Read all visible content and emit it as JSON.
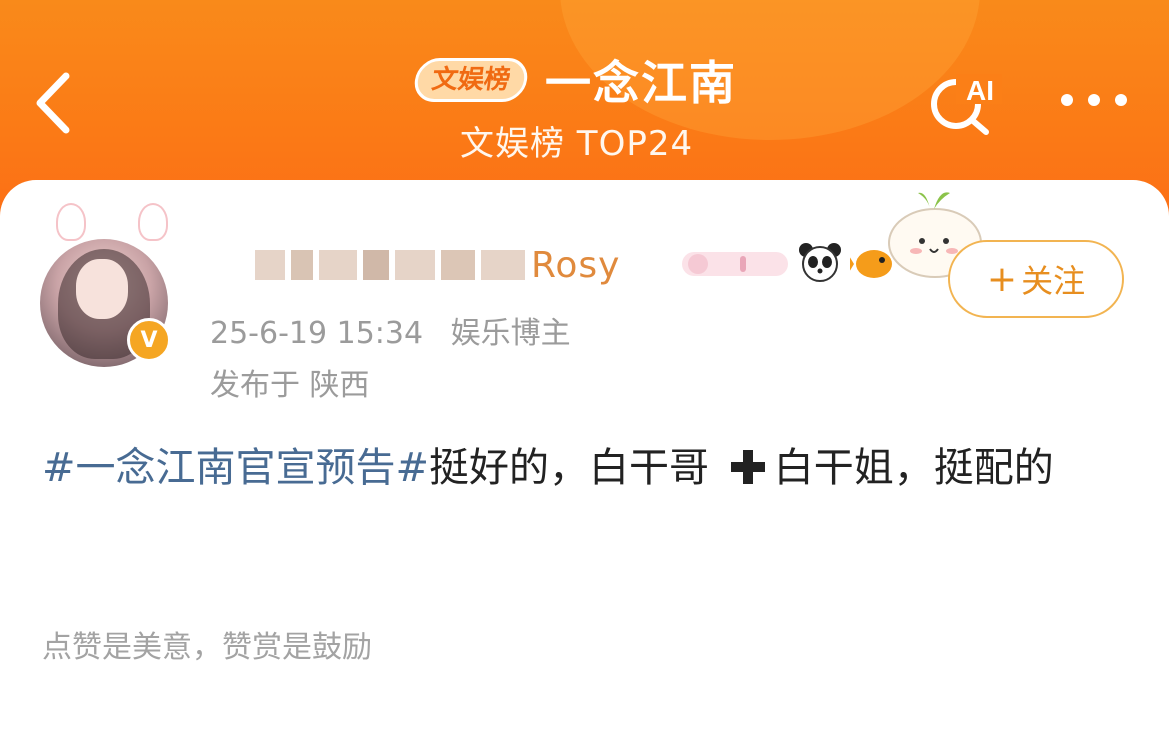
{
  "header": {
    "back_label": "返回",
    "badge": "文娱榜",
    "title": "一念江南",
    "subtitle": "文娱榜 TOP24",
    "ai_label": "AI"
  },
  "post": {
    "username_visible": "Rosy",
    "timestamp": "25-6-19 15:34",
    "role": "娱乐博主",
    "location": "发布于 陕西",
    "follow_label": "关注",
    "hashtag": "#一念江南官宣预告#",
    "text_part1": "挺好的，白干哥",
    "text_part2": "白干姐，挺配的",
    "reward_tip": "点赞是美意，赞赏是鼓励"
  },
  "colors": {
    "header_orange": "#fb7a16",
    "follow_orange": "#e78e1f",
    "hashtag_blue": "#486b93"
  },
  "icons": [
    "chevron-left-icon",
    "ai-search-icon",
    "more-dots-icon",
    "verified-icon",
    "plus-icon"
  ]
}
